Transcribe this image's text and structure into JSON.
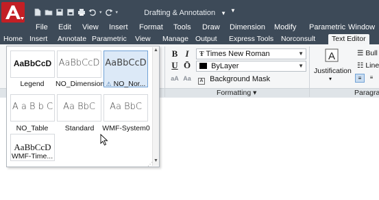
{
  "titlebar": {
    "workspace": "Drafting & Annotation",
    "qat_icons": [
      "new-icon",
      "open-icon",
      "save-icon",
      "save-as-icon",
      "plot-icon",
      "undo-icon",
      "redo-icon",
      "workspace-gear-icon"
    ]
  },
  "menubar": {
    "items": [
      "File",
      "Edit",
      "View",
      "Insert",
      "Format",
      "Tools",
      "Draw",
      "Dimension",
      "Modify",
      "Parametric",
      "Window"
    ]
  },
  "tabs": {
    "items": [
      "Home",
      "Insert",
      "Annotate",
      "Parametric",
      "View",
      "Manage",
      "Output",
      "Express Tools",
      "Norconsult",
      "Text Editor"
    ],
    "active": "Text Editor"
  },
  "gallery": {
    "styles": [
      {
        "sample": "AaBbCcD",
        "name": "Legend",
        "selected": false
      },
      {
        "sample": "AaBbCcD",
        "name": "NO_Dimension",
        "selected": false
      },
      {
        "sample": "AaBbCcD",
        "name": "NO_Nor...",
        "selected": true
      },
      {
        "sample": "A a B b C",
        "name": "NO_Table",
        "selected": false
      },
      {
        "sample": "Aa BbC",
        "name": "Standard",
        "selected": false
      },
      {
        "sample": "Aa BbC",
        "name": "WMF-System0",
        "selected": false
      },
      {
        "sample": "AaBbCcD",
        "name": "WMF-Time...",
        "selected": false
      }
    ]
  },
  "formatting": {
    "bold": "B",
    "italic": "I",
    "underline": "U",
    "overline": "Ō",
    "font": "Times New Roman",
    "color": "ByLayer",
    "background_mask": "Background Mask",
    "panel_label": "Formatting ▾"
  },
  "paragraph": {
    "justification": "Justification",
    "bullets": "Bull",
    "line_spacing": "Line",
    "panel_label": "Paragrap"
  },
  "colors": {
    "titlebar": "#3d4a58",
    "ribbon": "#f5f6f7",
    "selected_swatch": "#dce9f7",
    "logo_red": "#d9262b"
  }
}
